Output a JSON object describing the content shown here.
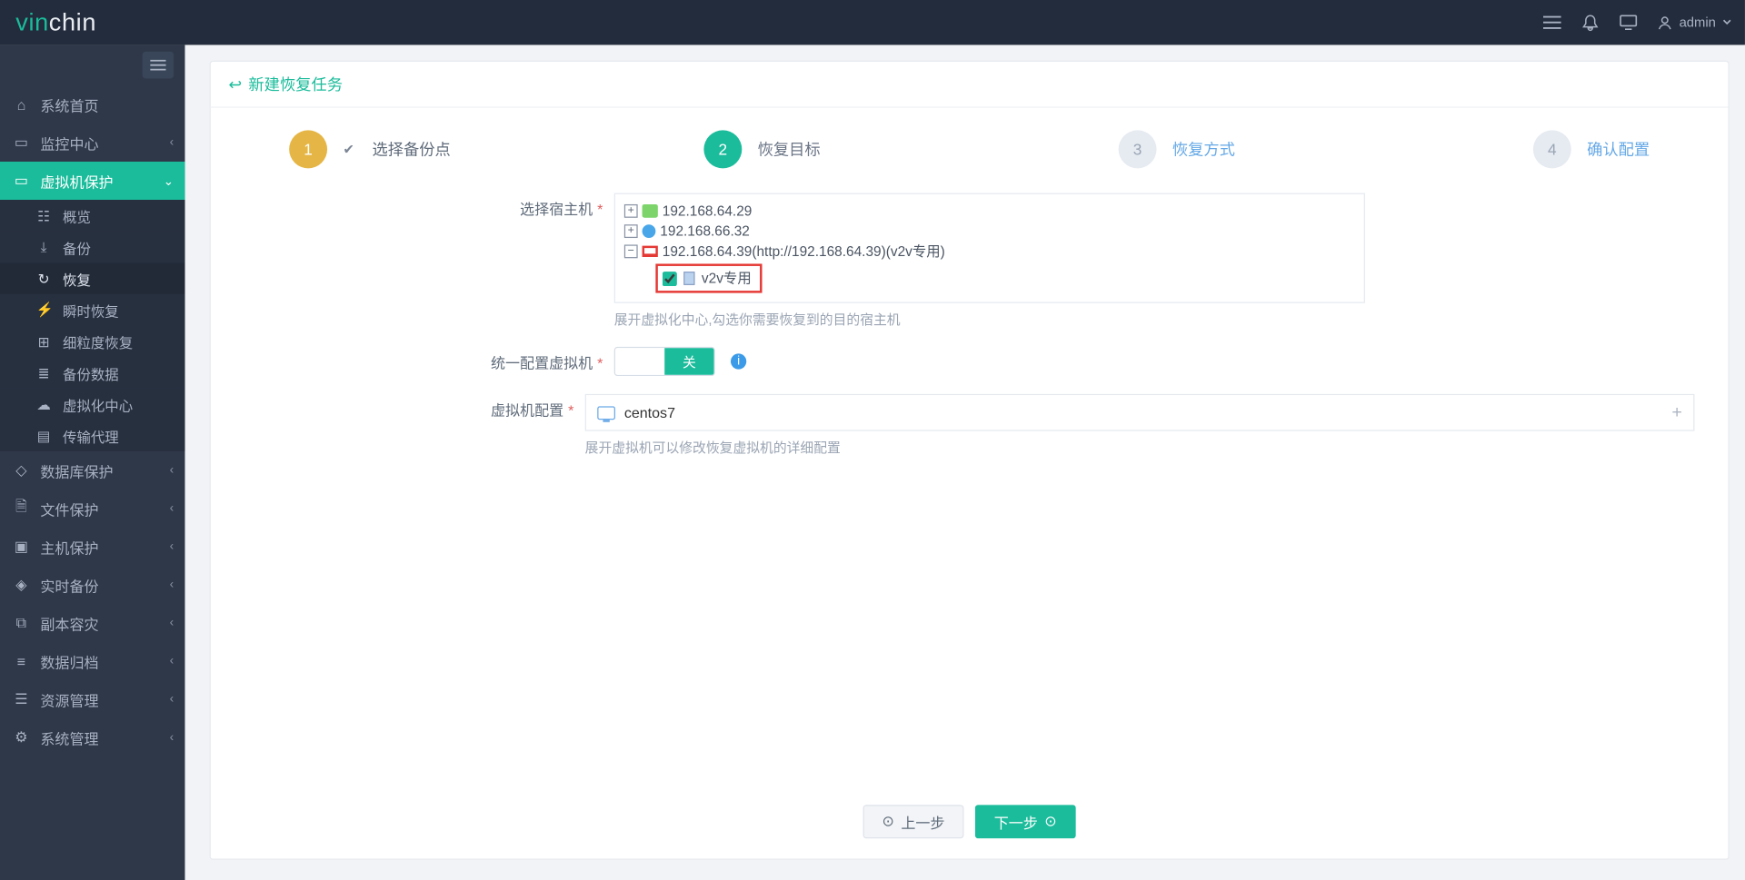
{
  "header": {
    "logo_a": "vin",
    "logo_b": "chin",
    "user": "admin"
  },
  "sidebar": {
    "items": [
      {
        "label": "系统首页",
        "icon": "home"
      },
      {
        "label": "监控中心",
        "icon": "monitor",
        "expandable": true
      },
      {
        "label": "虚拟机保护",
        "icon": "vm",
        "active": true,
        "expanded": true
      },
      {
        "label": "数据库保护",
        "icon": "db",
        "expandable": true
      },
      {
        "label": "文件保护",
        "icon": "file",
        "expandable": true
      },
      {
        "label": "主机保护",
        "icon": "host",
        "expandable": true
      },
      {
        "label": "实时备份",
        "icon": "shield",
        "expandable": true
      },
      {
        "label": "副本容灾",
        "icon": "copy",
        "expandable": true
      },
      {
        "label": "数据归档",
        "icon": "archive",
        "expandable": true
      },
      {
        "label": "资源管理",
        "icon": "res",
        "expandable": true
      },
      {
        "label": "系统管理",
        "icon": "gear",
        "expandable": true
      }
    ],
    "sub_vm": [
      {
        "label": "概览",
        "icon": "dash"
      },
      {
        "label": "备份",
        "icon": "save"
      },
      {
        "label": "恢复",
        "icon": "restore",
        "active": true
      },
      {
        "label": "瞬时恢复",
        "icon": "flash"
      },
      {
        "label": "细粒度恢复",
        "icon": "gran"
      },
      {
        "label": "备份数据",
        "icon": "data"
      },
      {
        "label": "虚拟化中心",
        "icon": "cloud"
      },
      {
        "label": "传输代理",
        "icon": "agent"
      }
    ]
  },
  "page": {
    "title": "新建恢复任务"
  },
  "wizard": {
    "steps": [
      {
        "num": "1",
        "label": "选择备份点",
        "state": "done"
      },
      {
        "num": "2",
        "label": "恢复目标",
        "state": "cur"
      },
      {
        "num": "3",
        "label": "恢复方式",
        "state": "todo"
      },
      {
        "num": "4",
        "label": "确认配置",
        "state": "todo"
      }
    ]
  },
  "form": {
    "host_label": "选择宿主机",
    "tree": {
      "n1": "192.168.64.29",
      "n2": "192.168.66.32",
      "n3": "192.168.64.39(http://192.168.64.39)(v2v专用)",
      "n3_child": "v2v专用",
      "n3_child_checked": true
    },
    "host_hint": "展开虚拟化中心,勾选你需要恢复到的目的宿主机",
    "unify_label": "统一配置虚拟机",
    "toggle_off": "关",
    "vmcfg_label": "虚拟机配置",
    "vmcfg_value": "centos7",
    "vmcfg_hint": "展开虚拟机可以修改恢复虚拟机的详细配置"
  },
  "buttons": {
    "prev": "上一步",
    "next": "下一步"
  }
}
